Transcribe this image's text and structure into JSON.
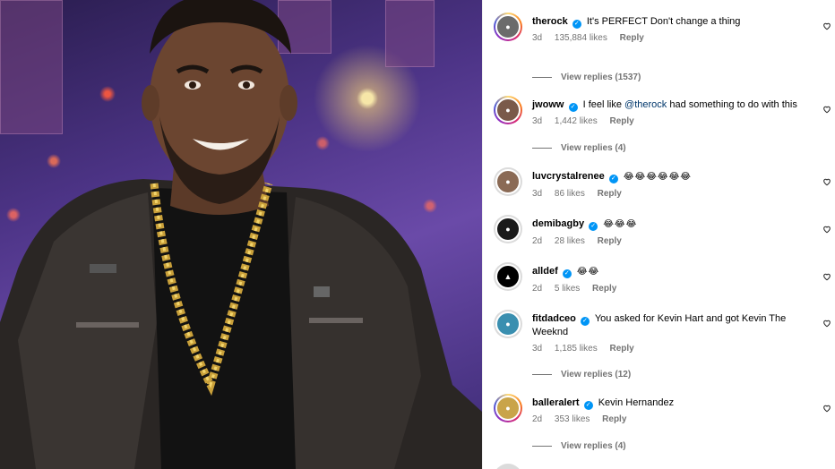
{
  "comments": [
    {
      "username": "therock",
      "text": "It's PERFECT Don't change a thing",
      "time": "3d",
      "likes": "135,884 likes",
      "reply_label": "Reply",
      "view_replies": "View replies (1537)",
      "avatar_color": "#6b6b6b"
    },
    {
      "username": "jwoww",
      "text_before": "I feel like ",
      "mention": "@therock",
      "text_after": " had something to do with this",
      "time": "3d",
      "likes": "1,442 likes",
      "reply_label": "Reply",
      "view_replies": "View replies (4)",
      "avatar_color": "#7a5a4a"
    },
    {
      "username": "luvcrystalrenee",
      "text": "😂😂😂😂😂😂",
      "time": "3d",
      "likes": "86 likes",
      "reply_label": "Reply",
      "avatar_color": "#8a6a55"
    },
    {
      "username": "demibagby",
      "text": "😂😂😂",
      "time": "2d",
      "likes": "28 likes",
      "reply_label": "Reply",
      "avatar_color": "#1a1a1a"
    },
    {
      "username": "alldef",
      "text": "😂😂",
      "time": "2d",
      "likes": "5 likes",
      "reply_label": "Reply",
      "avatar_color": "#000000"
    },
    {
      "username": "fitdadceo",
      "text": "You asked for Kevin Hart and got Kevin The Weeknd",
      "time": "3d",
      "likes": "1,185 likes",
      "reply_label": "Reply",
      "view_replies": "View replies (12)",
      "avatar_color": "#3a8fb0"
    },
    {
      "username": "balleralert",
      "text": "Kevin Hernandez",
      "time": "2d",
      "likes": "353 likes",
      "reply_label": "Reply",
      "view_replies": "View replies (4)",
      "avatar_color": "#c9a44a"
    }
  ],
  "icons": {
    "heart": "heart-outline-icon",
    "verified": "verified-badge-icon"
  },
  "colors": {
    "verified": "#0095f6",
    "meta_text": "#737373",
    "mention": "#00376b"
  }
}
